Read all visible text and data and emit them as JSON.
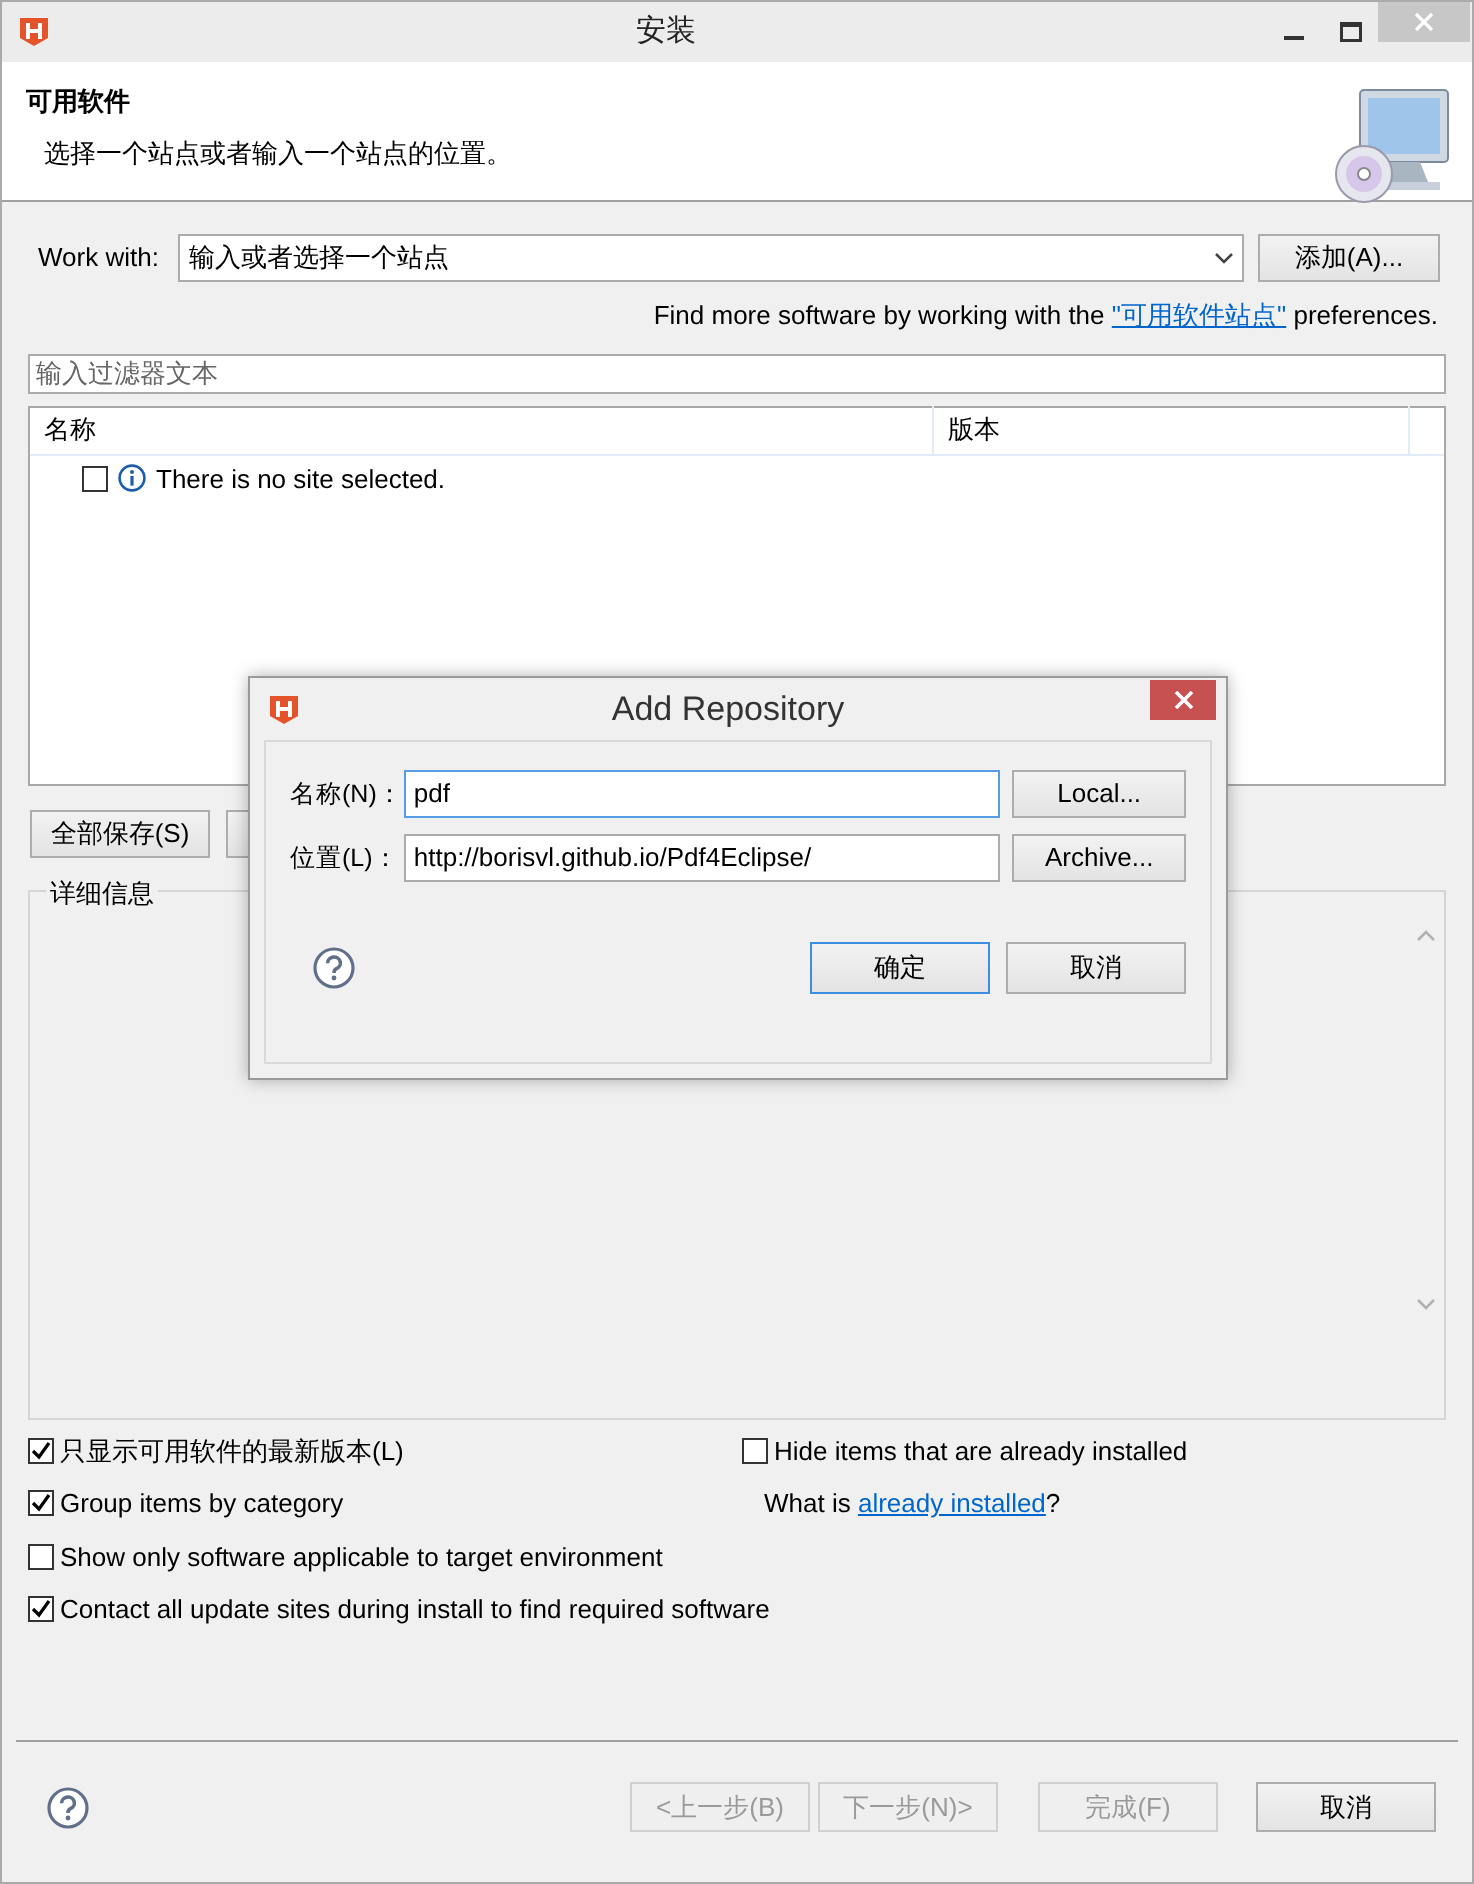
{
  "window": {
    "title": "安装"
  },
  "header": {
    "title": "可用软件",
    "description": "选择一个站点或者输入一个站点的位置。"
  },
  "work_with": {
    "label": "Work with:",
    "value": "输入或者选择一个站点",
    "button": "添加(A)..."
  },
  "find_more": {
    "before": "Find more software by working with the ",
    "link": "\"可用软件站点\"",
    "after": " preferences."
  },
  "filter": {
    "placeholder": "输入过滤器文本"
  },
  "table": {
    "columns": [
      "名称",
      "版本"
    ],
    "rows": [
      {
        "checked": false,
        "text": "There is no site selected."
      }
    ]
  },
  "table_buttons": [
    {
      "label": "全部保存(S)"
    }
  ],
  "details": {
    "title": "详细信息"
  },
  "options_left": [
    {
      "label": "只显示可用软件的最新版本(L)",
      "checked": true
    },
    {
      "label": "Group items by category",
      "checked": true
    },
    {
      "label": "Show only software applicable to target environment",
      "checked": false
    },
    {
      "label": "Contact all update sites during install to find required software",
      "checked": true
    }
  ],
  "options_right": [
    {
      "kind": "checkbox",
      "label": "Hide items that are already installed",
      "checked": false
    },
    {
      "kind": "note",
      "before": "What is ",
      "link": "already installed",
      "after": "?"
    }
  ],
  "footer": {
    "buttons": [
      {
        "label": "<上一步(B)",
        "disabled": true
      },
      {
        "label": "下一步(N)>",
        "disabled": true
      },
      {
        "label": "完成(F)",
        "disabled": true
      },
      {
        "label": "取消",
        "disabled": false
      }
    ]
  },
  "dialog": {
    "title": "Add Repository",
    "fields": [
      {
        "label": "名称(N)：",
        "value": "pdf",
        "focused": true,
        "button": "Local..."
      },
      {
        "label": "位置(L)：",
        "value": "http://borisvl.github.io/Pdf4Eclipse/",
        "focused": false,
        "button": "Archive..."
      }
    ],
    "buttons": [
      {
        "label": "确定",
        "default": true
      },
      {
        "label": "取消",
        "default": false
      }
    ]
  }
}
